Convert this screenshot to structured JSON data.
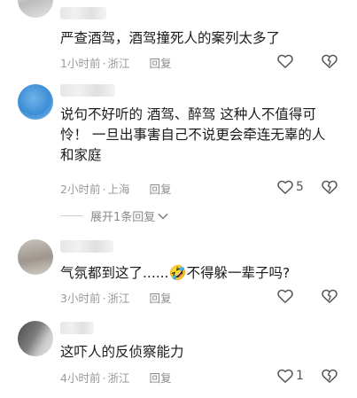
{
  "comments": [
    {
      "text": "严查酒驾，酒驾撞死人的案列太多了",
      "time": "1小时前",
      "location": "浙江",
      "reply_label": "回复",
      "like_count": ""
    },
    {
      "text": "说句不好听的  酒驾、醉驾 这种人不值得可怜！ 一旦出事害自己不说更会牵连无辜的人和家庭",
      "time": "2小时前",
      "location": "上海",
      "reply_label": "回复",
      "like_count": "5",
      "expand_label": "展开1条回复"
    },
    {
      "text_before": "气氛都到这了......",
      "emoji": "🤣",
      "text_after": "不得躲一辈子吗?",
      "time": "3小时前",
      "location": "浙江",
      "reply_label": "回复",
      "like_count": ""
    },
    {
      "text": "这吓人的反侦察能力",
      "time": "4小时前",
      "location": "浙江",
      "reply_label": "回复",
      "like_count": "1"
    }
  ],
  "separator": "·",
  "icons": [
    "heart-icon",
    "dislike-heart-icon",
    "chevron-down-icon"
  ],
  "colors": {
    "text": "#1b1b1b",
    "meta": "#9a9a9a",
    "icon": "#555555"
  }
}
